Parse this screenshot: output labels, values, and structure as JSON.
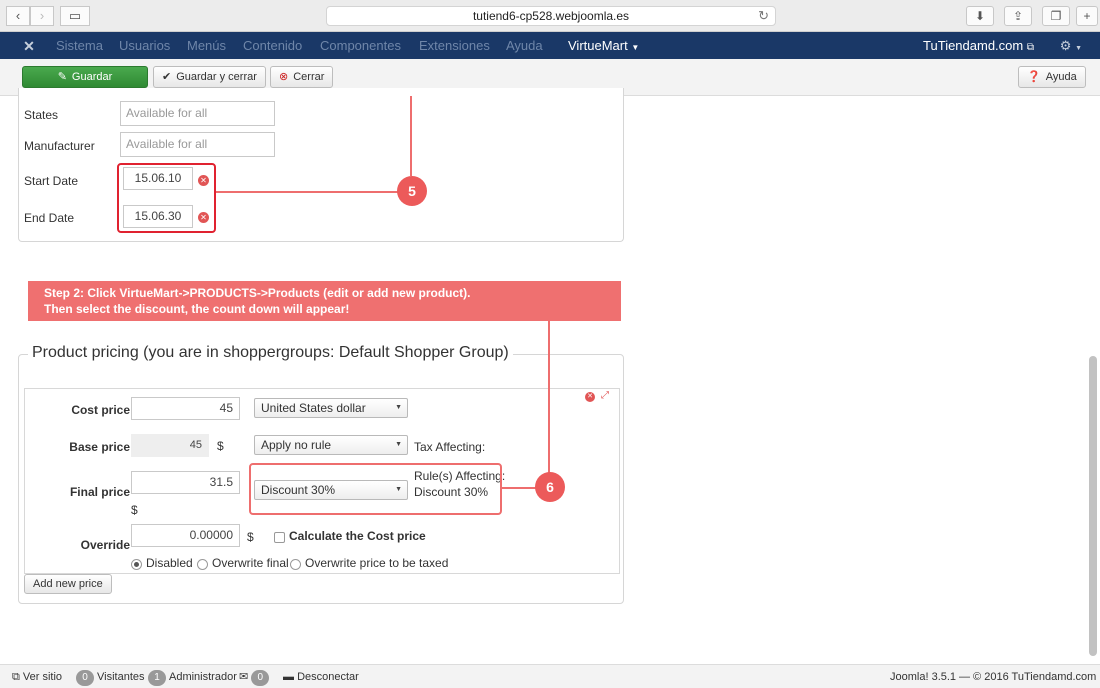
{
  "browser": {
    "url": "tutiend6-cp528.webjoomla.es"
  },
  "admin_menu": {
    "items": [
      "Sistema",
      "Usuarios",
      "Menús",
      "Contenido",
      "Componentes",
      "Extensiones",
      "Ayuda",
      "VirtueMart"
    ],
    "active": "VirtueMart",
    "site_name": "TuTiendamd.com"
  },
  "toolbar": {
    "save_label": "Guardar",
    "save_close_label": "Guardar y cerrar",
    "close_label": "Cerrar",
    "help_label": "Ayuda"
  },
  "discount_form": {
    "states_label": "States",
    "states_placeholder": "Available for all",
    "manufacturer_label": "Manufacturer",
    "manufacturer_placeholder": "Available for all",
    "start_date_label": "Start Date",
    "start_date_value": "15.06.10",
    "end_date_label": "End Date",
    "end_date_value": "15.06.30"
  },
  "annotations": {
    "step5": "5",
    "step6": "6",
    "banner_line1": "Step 2: Click VirtueMart->PRODUCTS->Products (edit or add new product).",
    "banner_line2": "Then select the discount, the count down will appear!"
  },
  "pricing": {
    "legend": "Product pricing (you are in shoppergroups: Default Shopper Group)",
    "cost_price_label": "Cost price",
    "cost_price_value": "45",
    "currency": "United States dollar",
    "base_price_label": "Base price",
    "base_price_value": "45",
    "base_currency_symbol": "$",
    "tax_rule": "Apply no rule",
    "tax_affecting": "Tax Affecting:",
    "final_price_label": "Final price",
    "final_price_value": "31.5",
    "final_currency_symbol": "$",
    "discount_rule": "Discount 30%",
    "rules_affecting": "Rule(s) Affecting:",
    "rules_affecting_value": "Discount 30%",
    "override_label": "Override",
    "override_value": "0.00000",
    "override_currency_symbol": "$",
    "calculate_cost_label": "Calculate the Cost price",
    "radio_disabled": "Disabled",
    "radio_overwrite_final": "Overwrite final",
    "radio_overwrite_taxed": "Overwrite price to be taxed",
    "add_price_label": "Add new price"
  },
  "status_bar": {
    "view_site": "Ver sitio",
    "visitors_count": "0",
    "visitors_label": "Visitantes",
    "admin_count": "1",
    "admin_label": "Administrador",
    "messages_count": "0",
    "logout_label": "Desconectar",
    "version": "Joomla! 3.5.1",
    "copyright": "— © 2016 TuTiendamd.com"
  }
}
